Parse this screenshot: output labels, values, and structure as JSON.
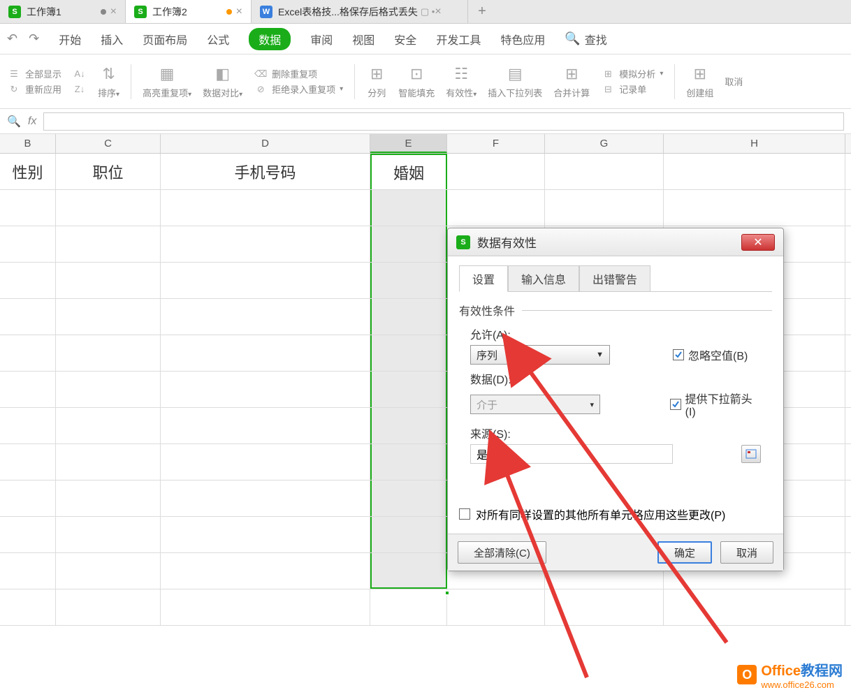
{
  "tabs": {
    "t1": "工作簿1",
    "t2": "工作簿2",
    "t3": "Excel表格技...格保存后格式丢失"
  },
  "menu": {
    "start": "开始",
    "insert": "插入",
    "page": "页面布局",
    "formula": "公式",
    "data": "数据",
    "review": "审阅",
    "view": "视图",
    "security": "安全",
    "dev": "开发工具",
    "special": "特色应用",
    "search": "查找"
  },
  "ribbon": {
    "displayAll": "全部显示",
    "reapply": "重新应用",
    "sort": "排序",
    "highlight": "高亮重复项",
    "dataCompare": "数据对比",
    "deleteDup": "删除重复项",
    "rejectDup": "拒绝录入重复项",
    "splitCol": "分列",
    "smartFill": "智能填充",
    "validity": "有效性",
    "insertDrop": "插入下拉列表",
    "consolidate": "合并计算",
    "simAnalysis": "模拟分析",
    "record": "记录单",
    "createGroup": "创建组",
    "ungroup": "取消"
  },
  "columns": {
    "B": "B",
    "C": "C",
    "D": "D",
    "E": "E",
    "F": "F",
    "G": "G",
    "H": "H"
  },
  "headers": {
    "B": "性别",
    "C": "职位",
    "D": "手机号码",
    "E": "婚姻"
  },
  "dialog": {
    "title": "数据有效性",
    "tabSettings": "设置",
    "tabInput": "输入信息",
    "tabError": "出错警告",
    "criteria": "有效性条件",
    "allow": "允许(A):",
    "allowValue": "序列",
    "data": "数据(D):",
    "dataValue": "介于",
    "source": "来源(S):",
    "sourceValue": "是,否",
    "ignoreBlank": "忽略空值(B)",
    "provideDropdown": "提供下拉箭头(I)",
    "applyAll": "对所有同样设置的其他所有单元格应用这些更改(P)",
    "clearAll": "全部清除(C)",
    "ok": "确定",
    "cancel": "取消"
  },
  "watermark": {
    "brand1": "Office",
    "brand2": "教程网",
    "url": "www.office26.com"
  }
}
